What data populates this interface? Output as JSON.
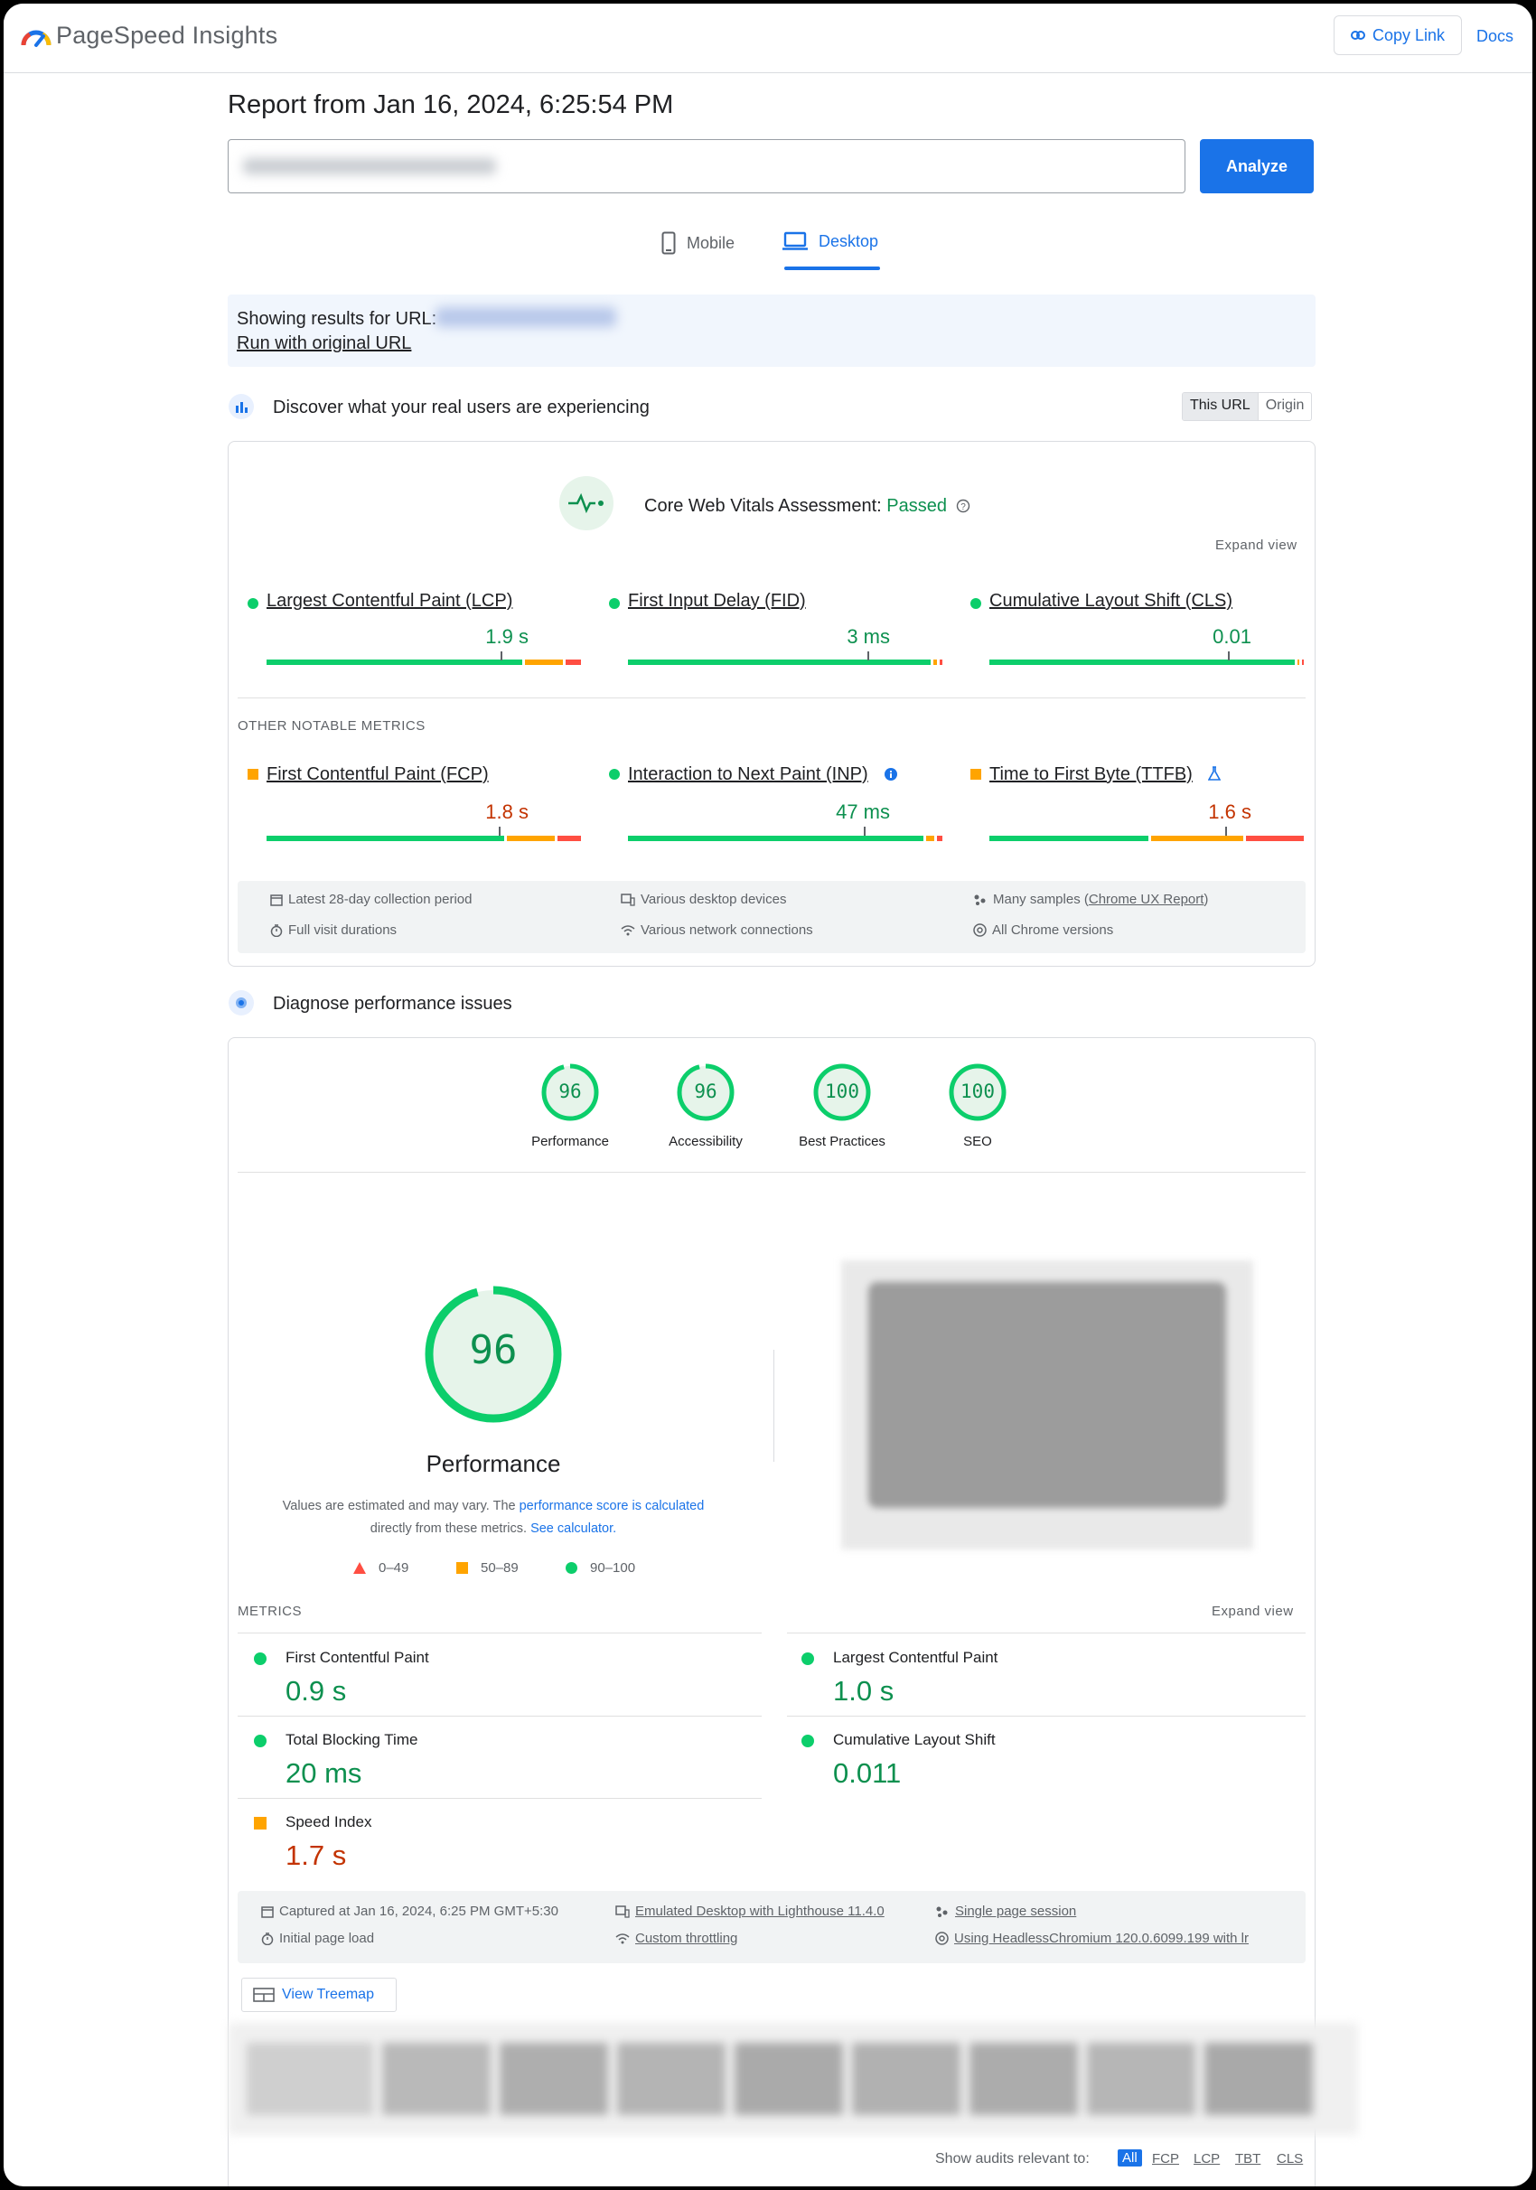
{
  "app": {
    "title": "PageSpeed Insights",
    "copy_link": "Copy Link",
    "docs": "Docs"
  },
  "report": {
    "title": "Report from Jan 16, 2024, 6:25:54 PM",
    "analyze": "Analyze"
  },
  "tabs": [
    {
      "label": "Mobile"
    },
    {
      "label": "Desktop"
    }
  ],
  "notice": {
    "text": "Showing results for URL:",
    "link": "Run with original URL"
  },
  "field": {
    "heading": "Discover what your real users are experiencing",
    "toggle": [
      "This URL",
      "Origin"
    ],
    "assessment_label": "Core Web Vitals Assessment:",
    "assessment_status": "Passed",
    "expand": "Expand view",
    "core_metrics": [
      {
        "name": "Largest Contentful Paint (LCP)",
        "value": "1.9 s",
        "status": "good",
        "marker": 0.75
      },
      {
        "name": "First Input Delay (FID)",
        "value": "3 ms",
        "status": "good",
        "marker": 0.75
      },
      {
        "name": "Cumulative Layout Shift (CLS)",
        "value": "0.01",
        "status": "good",
        "marker": 0.75
      }
    ],
    "other_label": "OTHER NOTABLE METRICS",
    "other_metrics": [
      {
        "name": "First Contentful Paint (FCP)",
        "value": "1.8 s",
        "status": "average",
        "marker": 0.75
      },
      {
        "name": "Interaction to Next Paint (INP)",
        "value": "47 ms",
        "status": "good",
        "marker": 0.75
      },
      {
        "name": "Time to First Byte (TTFB)",
        "value": "1.6 s",
        "status": "average",
        "marker": 0.75
      }
    ],
    "info": {
      "collection": "Latest 28-day collection period",
      "visits": "Full visit durations",
      "devices": "Various desktop devices",
      "network": "Various network connections",
      "samples_prefix": "Many samples (",
      "samples_link": "Chrome UX Report",
      "samples_suffix": ")",
      "chrome": "All Chrome versions"
    }
  },
  "lab": {
    "heading": "Diagnose performance issues",
    "scores": [
      {
        "value": "96",
        "label": "Performance"
      },
      {
        "value": "96",
        "label": "Accessibility"
      },
      {
        "value": "100",
        "label": "Best Practices"
      },
      {
        "value": "100",
        "label": "SEO"
      }
    ],
    "main_score": "96",
    "main_label": "Performance",
    "note_1": "Values are estimated and may vary. The ",
    "note_link_1": "performance score is calculated",
    "note_2": "directly from these metrics. ",
    "note_link_2": "See calculator.",
    "legend": [
      "0–49",
      "50–89",
      "90–100"
    ],
    "metrics_label": "METRICS",
    "expand": "Expand view",
    "metrics": [
      {
        "name": "First Contentful Paint",
        "value": "0.9 s",
        "status": "good"
      },
      {
        "name": "Largest Contentful Paint",
        "value": "1.0 s",
        "status": "good"
      },
      {
        "name": "Total Blocking Time",
        "value": "20 ms",
        "status": "good"
      },
      {
        "name": "Cumulative Layout Shift",
        "value": "0.011",
        "status": "good"
      },
      {
        "name": "Speed Index",
        "value": "1.7 s",
        "status": "average"
      }
    ],
    "info": {
      "captured": "Captured at Jan 16, 2024, 6:25 PM GMT+5:30",
      "initial": "Initial page load",
      "emulated": "Emulated Desktop with Lighthouse 11.4.0",
      "throttling": "Custom throttling",
      "session": "Single page session",
      "browser": "Using HeadlessChromium 120.0.6099.199 with lr"
    },
    "treemap": "View Treemap",
    "filter_label": "Show audits relevant to:",
    "filters": [
      "All",
      "FCP",
      "LCP",
      "TBT",
      "CLS"
    ]
  },
  "colors": {
    "accent": "#1a73e8",
    "good": "#0cce6b",
    "average": "#ffa400",
    "poor": "#ff4e42"
  }
}
